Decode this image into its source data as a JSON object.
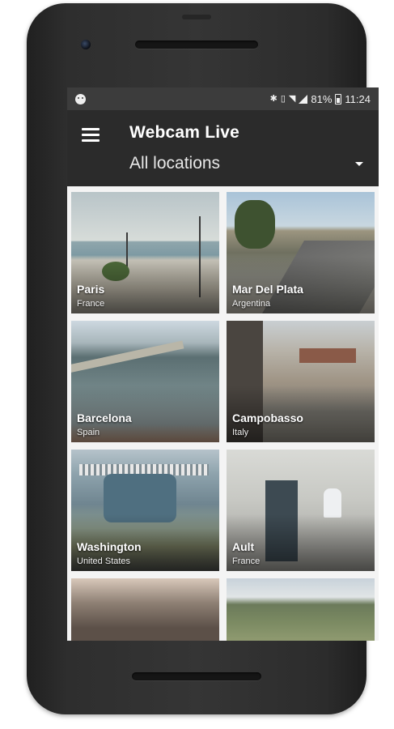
{
  "status_bar": {
    "battery_percent": "81%",
    "time": "11:24",
    "icons": [
      "notification-icon",
      "bluetooth-icon",
      "vibrate-icon",
      "wifi-icon",
      "signal-icon",
      "battery-icon"
    ]
  },
  "app_bar": {
    "title": "Webcam Live",
    "location_selected": "All locations",
    "menu_icon": "hamburger-menu-icon"
  },
  "webcams": [
    {
      "city": "Paris",
      "country": "France"
    },
    {
      "city": "Mar Del Plata",
      "country": "Argentina"
    },
    {
      "city": "Barcelona",
      "country": "Spain"
    },
    {
      "city": "Campobasso",
      "country": "Italy"
    },
    {
      "city": "Washington",
      "country": "United States"
    },
    {
      "city": "Ault",
      "country": "France"
    }
  ],
  "colors": {
    "app_bar_background": "#2b2b2b",
    "status_bar_background": "#3c3c3c",
    "grid_background": "#f4f4f4",
    "text_primary": "#ffffff"
  }
}
